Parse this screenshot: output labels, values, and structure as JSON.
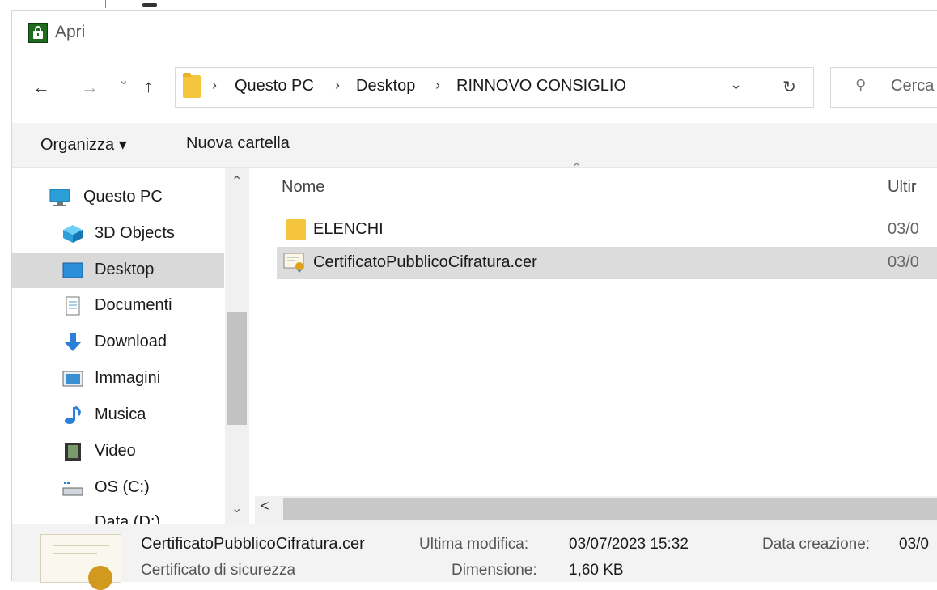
{
  "window": {
    "title": "Apri"
  },
  "nav": {
    "back": "←",
    "forward": "→",
    "recent": "⌄",
    "up": "↑",
    "breadcrumb": [
      "Questo PC",
      "Desktop",
      "RINNOVO CONSIGLIO"
    ],
    "separator": "›",
    "dropdown": "⌄",
    "refresh": "↻",
    "search_placeholder": "Cerca"
  },
  "commands": {
    "organize": "Organizza ▾",
    "new_folder": "Nuova cartella"
  },
  "sidebar": {
    "items": [
      {
        "label": "Questo PC",
        "icon": "pc-icon"
      },
      {
        "label": "3D Objects",
        "icon": "3d-objects-icon"
      },
      {
        "label": "Desktop",
        "icon": "desktop-icon",
        "selected": true
      },
      {
        "label": "Documenti",
        "icon": "documents-icon"
      },
      {
        "label": "Download",
        "icon": "download-icon"
      },
      {
        "label": "Immagini",
        "icon": "pictures-icon"
      },
      {
        "label": "Musica",
        "icon": "music-icon"
      },
      {
        "label": "Video",
        "icon": "video-icon"
      },
      {
        "label": "OS (C:)",
        "icon": "drive-icon"
      },
      {
        "label": "Data (D:)",
        "icon": "drive-icon"
      }
    ]
  },
  "files": {
    "columns": {
      "name": "Nome",
      "modified": "Ultir"
    },
    "rows": [
      {
        "name": "ELENCHI",
        "date": "03/0",
        "type": "folder",
        "selected": false
      },
      {
        "name": "CertificatoPubblicoCifratura.cer",
        "date": "03/0",
        "type": "certificate",
        "selected": true
      }
    ]
  },
  "details": {
    "filename": "CertificatoPubblicoCifratura.cer",
    "filetype": "Certificato di sicurezza",
    "modified_label": "Ultima modifica:",
    "modified_value": "03/07/2023 15:32",
    "size_label": "Dimensione:",
    "size_value": "1,60 KB",
    "created_label": "Data creazione:",
    "created_value": "03/0"
  },
  "colors": {
    "accent": "#0078d7",
    "selection": "#d9d9d9",
    "folder": "#f5c53e"
  }
}
